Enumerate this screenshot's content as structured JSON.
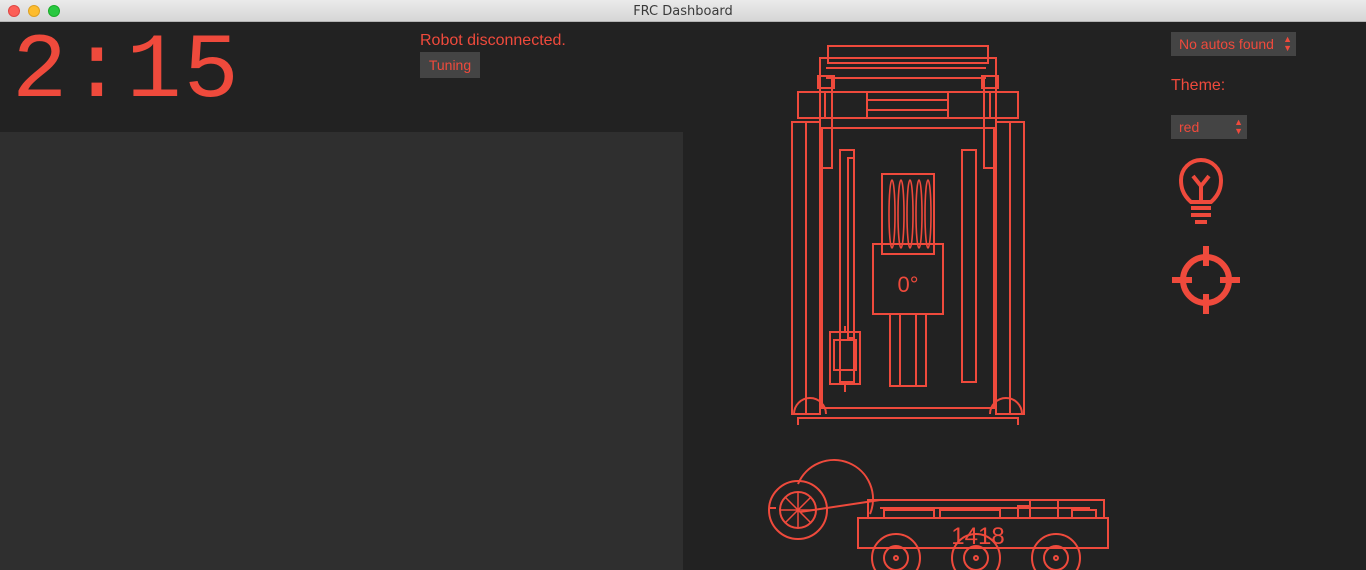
{
  "window": {
    "title": "FRC Dashboard"
  },
  "timer": {
    "value": "2:15"
  },
  "robot": {
    "status": "Robot disconnected.",
    "tuning_label": "Tuning",
    "angle": "0°",
    "team_number": "1418"
  },
  "autos": {
    "selected": "No autos found"
  },
  "theme": {
    "label": "Theme:",
    "selected": "red"
  },
  "icons": {
    "bulb": "lightbulb-icon",
    "target": "crosshair-icon"
  },
  "colors": {
    "accent": "#ef4a3c",
    "background": "#222222",
    "camera": "#2f2f2f",
    "control": "#444444"
  }
}
